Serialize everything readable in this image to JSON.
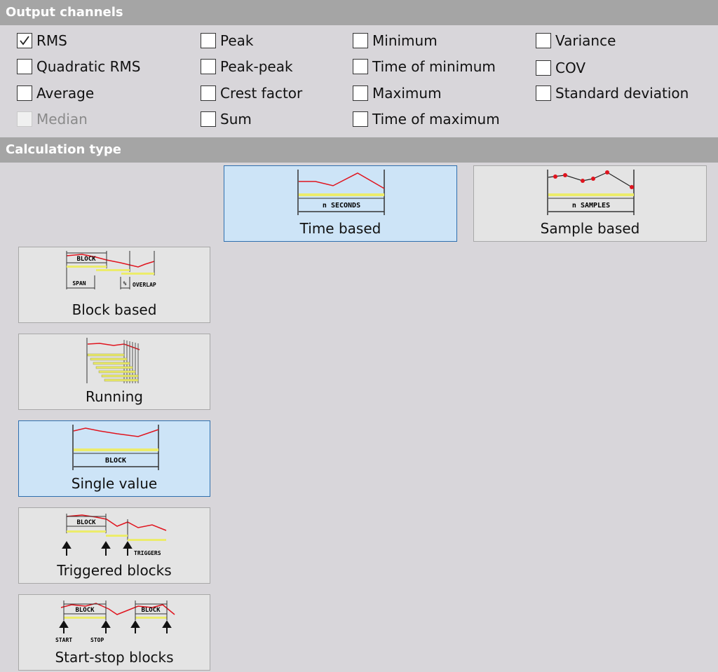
{
  "output_channels": {
    "title": "Output channels",
    "options": [
      {
        "label": "RMS",
        "checked": true,
        "enabled": true
      },
      {
        "label": "Quadratic RMS",
        "checked": false,
        "enabled": true
      },
      {
        "label": "Average",
        "checked": false,
        "enabled": true
      },
      {
        "label": "Median",
        "checked": false,
        "enabled": false
      },
      {
        "label": "Peak",
        "checked": false,
        "enabled": true
      },
      {
        "label": "Peak-peak",
        "checked": false,
        "enabled": true
      },
      {
        "label": "Crest factor",
        "checked": false,
        "enabled": true
      },
      {
        "label": "Sum",
        "checked": false,
        "enabled": true
      },
      {
        "label": "Minimum",
        "checked": false,
        "enabled": true
      },
      {
        "label": "Time of minimum",
        "checked": false,
        "enabled": true
      },
      {
        "label": "Maximum",
        "checked": false,
        "enabled": true
      },
      {
        "label": "Time of maximum",
        "checked": false,
        "enabled": true
      },
      {
        "label": "Variance",
        "checked": false,
        "enabled": true
      },
      {
        "label": "COV",
        "checked": false,
        "enabled": true
      },
      {
        "label": "Standard deviation",
        "checked": false,
        "enabled": true
      }
    ]
  },
  "calculation_type": {
    "title": "Calculation type",
    "selected": [
      "Time based",
      "Single value"
    ],
    "tiles": {
      "time_based": {
        "label": "Time based",
        "icon_text": "n SECONDS"
      },
      "sample_based": {
        "label": "Sample based",
        "icon_text": "n SAMPLES"
      },
      "block_based": {
        "label": "Block based",
        "icon_text": [
          "BLOCK",
          "SPAN",
          "OVERLAP",
          "%"
        ]
      },
      "running": {
        "label": "Running"
      },
      "single_value": {
        "label": "Single value",
        "icon_text": "BLOCK"
      },
      "triggered_blocks": {
        "label": "Triggered blocks",
        "icon_text": [
          "BLOCK",
          "TRIGGERS"
        ]
      },
      "start_stop_blocks": {
        "label": "Start-stop blocks",
        "icon_text": [
          "BLOCK",
          "BLOCK",
          "START",
          "STOP"
        ]
      }
    }
  },
  "colors": {
    "header_bg": "#a5a5a5",
    "panel_bg": "#d8d6da",
    "tile_bg": "#e4e4e4",
    "selected_bg": "#cde4f7",
    "selected_border": "#2f6fae",
    "signal": "#e0141e",
    "band": "#ecec6a"
  }
}
